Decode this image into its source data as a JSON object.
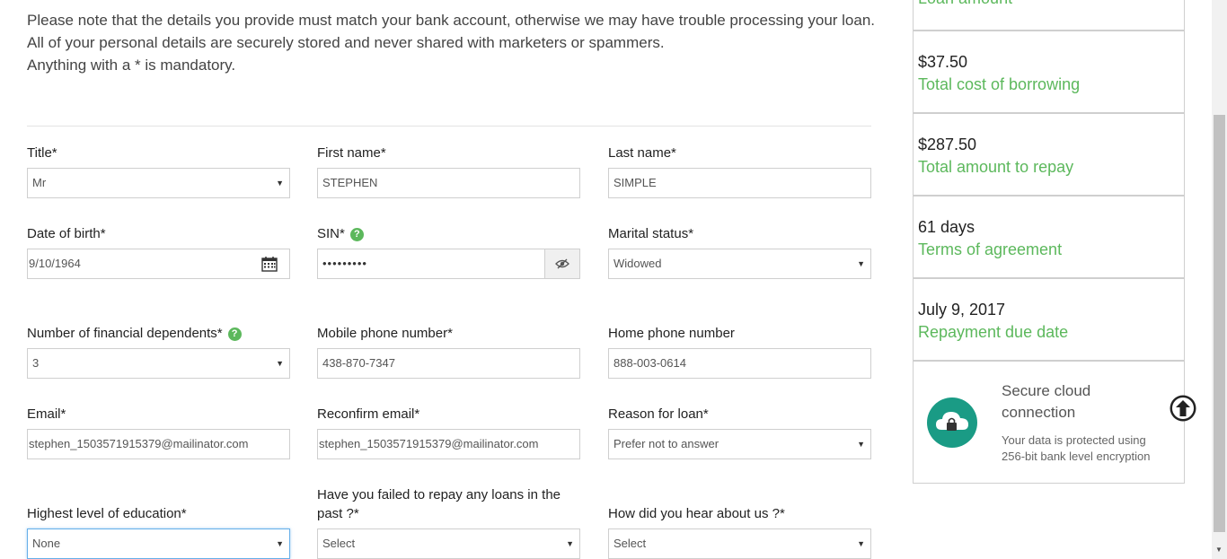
{
  "intro": {
    "line1": "Please note that the details you provide must match your bank account, otherwise we may have trouble processing your loan.",
    "line2": "All of your personal details are securely stored and never shared with marketers or spammers.",
    "line3": "Anything with a * is mandatory."
  },
  "form": {
    "title": {
      "label": "Title*",
      "value": "Mr"
    },
    "first_name": {
      "label": "First name*",
      "value": "STEPHEN"
    },
    "last_name": {
      "label": "Last name*",
      "value": "SIMPLE"
    },
    "dob": {
      "label": "Date of birth*",
      "value": "9/10/1964"
    },
    "sin": {
      "label": "SIN*",
      "value": "•••••••••"
    },
    "marital": {
      "label": "Marital status*",
      "value": "Widowed"
    },
    "dependents": {
      "label": "Number of financial dependents*",
      "value": "3"
    },
    "mobile": {
      "label": "Mobile phone number*",
      "value": "438-870-7347"
    },
    "home_phone": {
      "label": "Home phone number",
      "value": "888-003-0614"
    },
    "email": {
      "label": "Email*",
      "value": "stephen_1503571915379@mailinator.com"
    },
    "reconfirm_email": {
      "label": "Reconfirm email*",
      "value": "stephen_1503571915379@mailinator.com"
    },
    "reason": {
      "label": "Reason for loan*",
      "value": "Prefer not to answer"
    },
    "education": {
      "label": "Highest level of education*",
      "value": "None"
    },
    "failed_repay": {
      "label": "Have you failed to repay any loans in the past ?*",
      "value": "Select"
    },
    "hear_about": {
      "label": "How did you hear about us ?*",
      "value": "Select"
    }
  },
  "summary": {
    "loan_amount_caption": "Loan amount",
    "cost": {
      "value": "$37.50",
      "caption": "Total cost of borrowing"
    },
    "repay": {
      "value": "$287.50",
      "caption": "Total amount to repay"
    },
    "terms": {
      "value": "61 days",
      "caption": "Terms of agreement"
    },
    "due": {
      "value": "July 9, 2017",
      "caption": "Repayment due date"
    },
    "secure": {
      "heading": "Secure cloud connection",
      "text": "Your data is protected using 256-bit bank level encryption"
    }
  },
  "colors": {
    "accent_green": "#5cb85c",
    "secure_teal": "#1a9b85"
  },
  "icons": [
    "calendar-icon",
    "eye-slash-icon",
    "help-icon",
    "chevron-down-icon",
    "cloud-lock-icon",
    "arrow-up-circle-icon"
  ]
}
